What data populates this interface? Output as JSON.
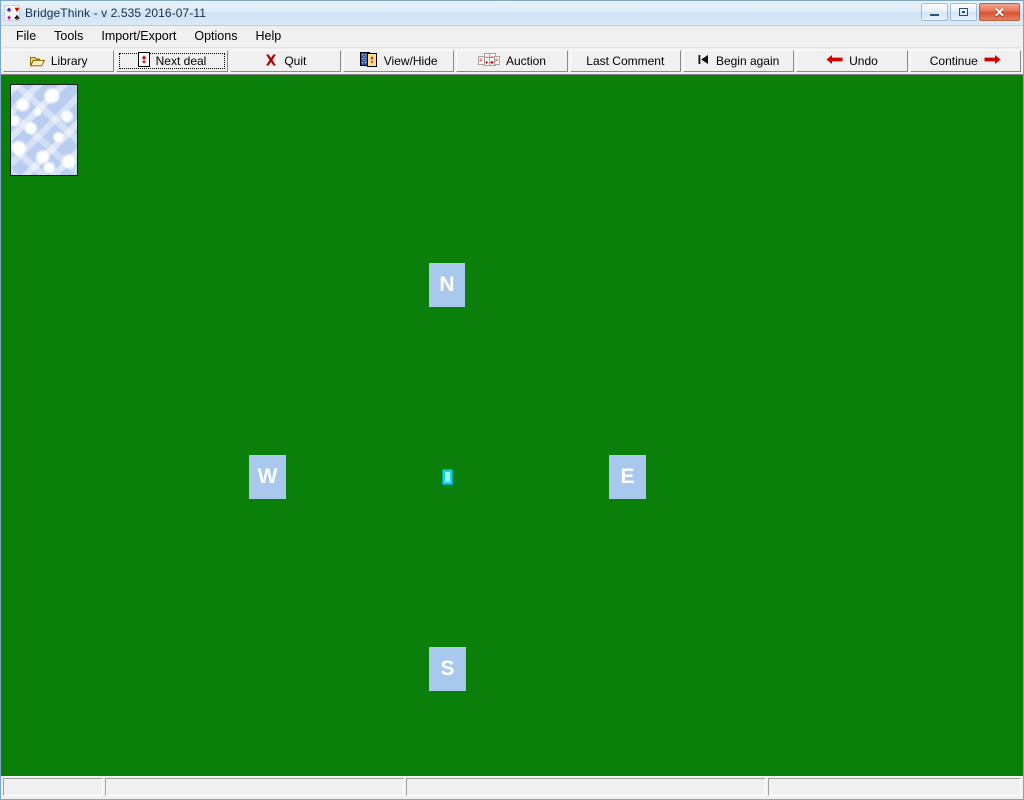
{
  "window": {
    "title": "BridgeThink - v 2.535  2016-07-11",
    "app_icon": "bridge-suits-icon",
    "controls": {
      "minimize": "minimize-icon",
      "maximize": "maximize-icon",
      "close": "✕"
    }
  },
  "menubar": {
    "items": [
      {
        "label": "File",
        "name": "menu-file"
      },
      {
        "label": "Tools",
        "name": "menu-tools"
      },
      {
        "label": "Import/Export",
        "name": "menu-import-export"
      },
      {
        "label": "Options",
        "name": "menu-options"
      },
      {
        "label": "Help",
        "name": "menu-help"
      }
    ]
  },
  "toolbar": {
    "buttons": [
      {
        "label": "Library",
        "icon": "open-folder-icon",
        "focused": false
      },
      {
        "label": "Next deal",
        "icon": "card-deal-icon",
        "focused": true
      },
      {
        "label": "Quit",
        "icon": "red-x-icon",
        "focused": false
      },
      {
        "label": "View/Hide",
        "icon": "cards-view-icon",
        "focused": false
      },
      {
        "label": "Auction",
        "icon": "bidding-cards-icon",
        "focused": false
      },
      {
        "label": "Last Comment",
        "icon": "",
        "focused": false
      },
      {
        "label": "Begin again",
        "icon": "skip-back-icon",
        "focused": false
      },
      {
        "label": "Undo",
        "icon": "arrow-left-icon",
        "focused": false
      },
      {
        "label": "Continue",
        "icon": "arrow-right-icon",
        "focused": false
      }
    ]
  },
  "table": {
    "felt_color": "#0a800a",
    "card_back": {
      "name": "card-back-thumbnail",
      "pattern": "blue-cloud-marble"
    },
    "seats": [
      {
        "id": "north",
        "label": "N"
      },
      {
        "id": "west",
        "label": "W"
      },
      {
        "id": "east",
        "label": "E"
      },
      {
        "id": "south",
        "label": "S"
      }
    ],
    "seat_color": "#a8c8ee",
    "seat_text_color": "#ffffff",
    "center_marker": {
      "name": "center-dealer-marker",
      "color": "#14d8d8"
    }
  },
  "statusbar": {
    "panels": [
      {
        "text": ""
      },
      {
        "text": ""
      },
      {
        "text": ""
      },
      {
        "text": ""
      }
    ]
  }
}
